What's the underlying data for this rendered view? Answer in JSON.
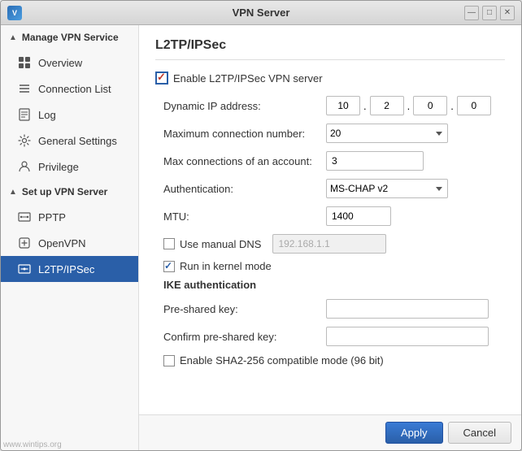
{
  "window": {
    "title": "VPN Server",
    "icon": "V"
  },
  "title_controls": {
    "minimize": "—",
    "maximize": "□",
    "close": "✕"
  },
  "sidebar": {
    "manage_section_label": "Manage VPN Service",
    "items": [
      {
        "id": "overview",
        "label": "Overview",
        "icon": "overview"
      },
      {
        "id": "connection-list",
        "label": "Connection List",
        "icon": "connection"
      },
      {
        "id": "log",
        "label": "Log",
        "icon": "log"
      },
      {
        "id": "general-settings",
        "label": "General Settings",
        "icon": "settings"
      },
      {
        "id": "privilege",
        "label": "Privilege",
        "icon": "privilege"
      }
    ],
    "setup_section_label": "Set up VPN Server",
    "setup_items": [
      {
        "id": "pptp",
        "label": "PPTP",
        "icon": "pptp"
      },
      {
        "id": "openvpn",
        "label": "OpenVPN",
        "icon": "openvpn"
      },
      {
        "id": "l2tp",
        "label": "L2TP/IPSec",
        "icon": "l2tp",
        "active": true
      }
    ]
  },
  "main": {
    "title": "L2TP/IPSec",
    "enable_label": "Enable L2TP/IPSec VPN server",
    "enable_checked": true,
    "fields": {
      "dynamic_ip_label": "Dynamic IP address:",
      "ip_octet1": "10",
      "ip_octet2": "2",
      "ip_octet3": "0",
      "ip_octet4": "0",
      "max_connections_label": "Maximum connection number:",
      "max_connections_value": "20",
      "max_account_label": "Max connections of an account:",
      "max_account_value": "3",
      "auth_label": "Authentication:",
      "auth_value": "MS-CHAP v2",
      "mtu_label": "MTU:",
      "mtu_value": "1400",
      "use_manual_dns_label": "Use manual DNS",
      "use_manual_dns_checked": false,
      "dns_ip_placeholder": "192.168.1.1",
      "run_kernel_label": "Run in kernel mode",
      "run_kernel_checked": true
    },
    "ike_section": {
      "label": "IKE authentication",
      "pre_shared_key_label": "Pre-shared key:",
      "confirm_psk_label": "Confirm pre-shared key:",
      "sha2_label": "Enable SHA2-256 compatible mode (96 bit)",
      "sha2_checked": false
    },
    "footer": {
      "apply_label": "Apply",
      "cancel_label": "Cancel"
    }
  },
  "watermark": "www.wintips.org"
}
